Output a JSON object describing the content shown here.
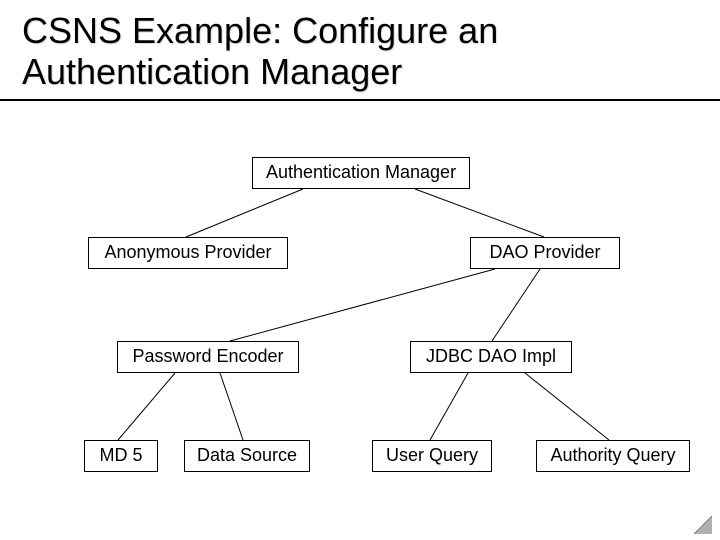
{
  "title": "CSNS Example: Configure an Authentication Manager",
  "nodes": {
    "auth_manager": "Authentication Manager",
    "anon_provider": "Anonymous Provider",
    "dao_provider": "DAO Provider",
    "password_encoder": "Password Encoder",
    "jdbc_dao_impl": "JDBC DAO Impl",
    "md5": "MD 5",
    "data_source": "Data Source",
    "user_query": "User Query",
    "authority_query": "Authority Query"
  }
}
